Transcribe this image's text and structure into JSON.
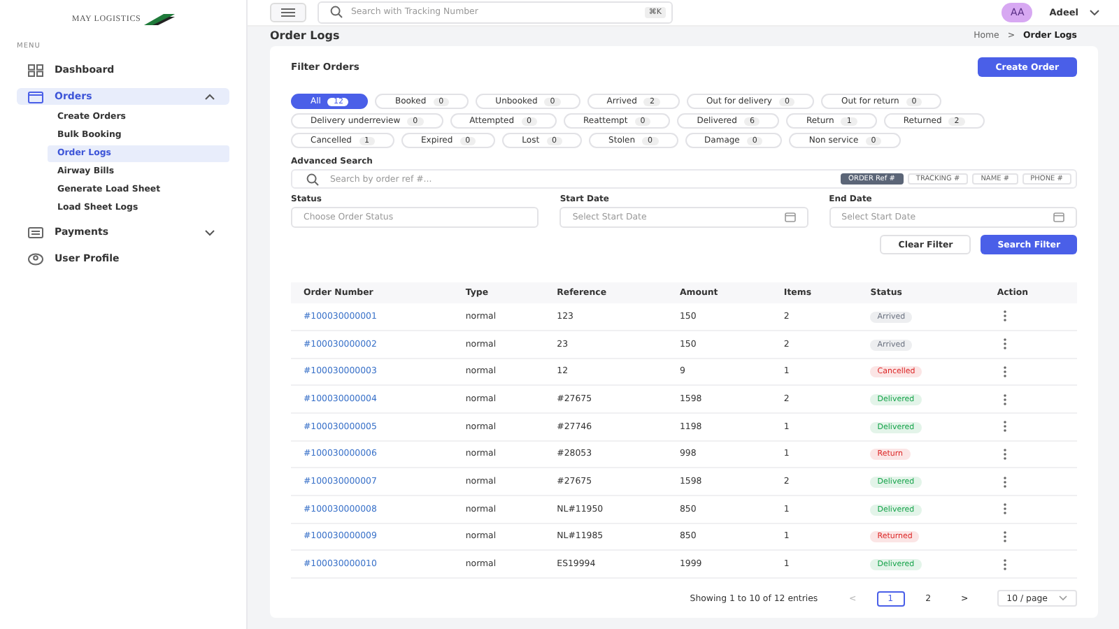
{
  "sidebar": {
    "logo": "MAY LOGISTICS",
    "section": "MENU",
    "items": [
      {
        "label": "Dashboard",
        "selected": false
      },
      {
        "label": "Orders",
        "selected": true,
        "expanded": true,
        "children": [
          {
            "label": "Create Orders",
            "selected": false
          },
          {
            "label": "Bulk Booking",
            "selected": false
          },
          {
            "label": "Order Logs",
            "selected": true
          },
          {
            "label": "Airway Bills",
            "selected": false
          },
          {
            "label": "Generate Load Sheet",
            "selected": false
          },
          {
            "label": "Load Sheet Logs",
            "selected": false
          }
        ]
      },
      {
        "label": "Payments",
        "selected": false,
        "expanded": false
      },
      {
        "label": "User Profile",
        "selected": false
      }
    ]
  },
  "topbar": {
    "search": {
      "placeholder": "Search with Tracking Number",
      "shortcut": "⌘K"
    },
    "avatar": "AA",
    "user": "Adeel"
  },
  "page": {
    "title": "Order Logs",
    "breadcrumb": [
      "Home",
      "Order Logs"
    ],
    "separator": ">"
  },
  "filter": {
    "title": "Filter Orders",
    "create_button": "Create Order",
    "chips": [
      {
        "label": "All",
        "count": "12",
        "selected": true
      },
      {
        "label": "Booked",
        "count": "0",
        "selected": false
      },
      {
        "label": "Unbooked",
        "count": "0",
        "selected": false
      },
      {
        "label": "Arrived",
        "count": "2",
        "selected": false
      },
      {
        "label": "Out for delivery",
        "count": "0",
        "selected": false
      },
      {
        "label": "Out for return",
        "count": "0",
        "selected": false
      },
      {
        "label": "Delivery underreview",
        "count": "0",
        "selected": false
      },
      {
        "label": "Attempted",
        "count": "0",
        "selected": false
      },
      {
        "label": "Reattempt",
        "count": "0",
        "selected": false
      },
      {
        "label": "Delivered",
        "count": "6",
        "selected": false
      },
      {
        "label": "Return",
        "count": "1",
        "selected": false
      },
      {
        "label": "Returned",
        "count": "2",
        "selected": false
      },
      {
        "label": "Cancelled",
        "count": "1",
        "selected": false
      },
      {
        "label": "Expired",
        "count": "0",
        "selected": false
      },
      {
        "label": "Lost",
        "count": "0",
        "selected": false
      },
      {
        "label": "Stolen",
        "count": "0",
        "selected": false
      },
      {
        "label": "Damage",
        "count": "0",
        "selected": false
      },
      {
        "label": "Non service",
        "count": "0",
        "selected": false
      }
    ],
    "advanced_label": "Advanced Search",
    "search_placeholder": "Search by order ref #...",
    "search_modes": [
      {
        "label": "ORDER Ref #",
        "selected": true
      },
      {
        "label": "TRACKING #",
        "selected": false
      },
      {
        "label": "NAME #",
        "selected": false
      },
      {
        "label": "PHONE #",
        "selected": false
      }
    ],
    "fields": [
      {
        "label": "Status",
        "placeholder": "Choose Order Status",
        "kind": "select"
      },
      {
        "label": "Start Date",
        "placeholder": "Select Start Date",
        "kind": "date"
      },
      {
        "label": "End Date",
        "placeholder": "Select Start Date",
        "kind": "date"
      }
    ],
    "clear_button": "Clear Filter",
    "search_button": "Search Filter"
  },
  "table": {
    "columns": [
      "Order Number",
      "Type",
      "Reference",
      "Amount",
      "Items",
      "Status",
      "Action"
    ],
    "rows": [
      {
        "order": "#100030000001",
        "type": "normal",
        "reference": "123",
        "amount": "150",
        "items": "2",
        "status": "Arrived",
        "color": "#6b7280"
      },
      {
        "order": "#100030000002",
        "type": "normal",
        "reference": "23",
        "amount": "150",
        "items": "2",
        "status": "Arrived",
        "color": "#6b7280"
      },
      {
        "order": "#100030000003",
        "type": "normal",
        "reference": "12",
        "amount": "9",
        "items": "1",
        "status": "Cancelled",
        "color": "#dc2626"
      },
      {
        "order": "#100030000004",
        "type": "normal",
        "reference": "#27675",
        "amount": "1598",
        "items": "2",
        "status": "Delivered",
        "color": "#16a34a"
      },
      {
        "order": "#100030000005",
        "type": "normal",
        "reference": "#27746",
        "amount": "1198",
        "items": "1",
        "status": "Delivered",
        "color": "#16a34a"
      },
      {
        "order": "#100030000006",
        "type": "normal",
        "reference": "#28053",
        "amount": "998",
        "items": "1",
        "status": "Return",
        "color": "#dc2626"
      },
      {
        "order": "#100030000007",
        "type": "normal",
        "reference": "#27675",
        "amount": "1598",
        "items": "2",
        "status": "Delivered",
        "color": "#16a34a"
      },
      {
        "order": "#100030000008",
        "type": "normal",
        "reference": "NL#11950",
        "amount": "850",
        "items": "1",
        "status": "Delivered",
        "color": "#16a34a"
      },
      {
        "order": "#100030000009",
        "type": "normal",
        "reference": "NL#11985",
        "amount": "850",
        "items": "1",
        "status": "Returned",
        "color": "#dc2626"
      },
      {
        "order": "#100030000010",
        "type": "normal",
        "reference": "ES19994",
        "amount": "1999",
        "items": "1",
        "status": "Delivered",
        "color": "#16a34a"
      }
    ]
  },
  "pagination": {
    "summary": "Showing 1 to 10 of 12 entries",
    "prev": "<",
    "next": ">",
    "pages": [
      {
        "label": "1",
        "selected": true
      },
      {
        "label": "2",
        "selected": false
      }
    ],
    "page_size": "10 / page"
  }
}
